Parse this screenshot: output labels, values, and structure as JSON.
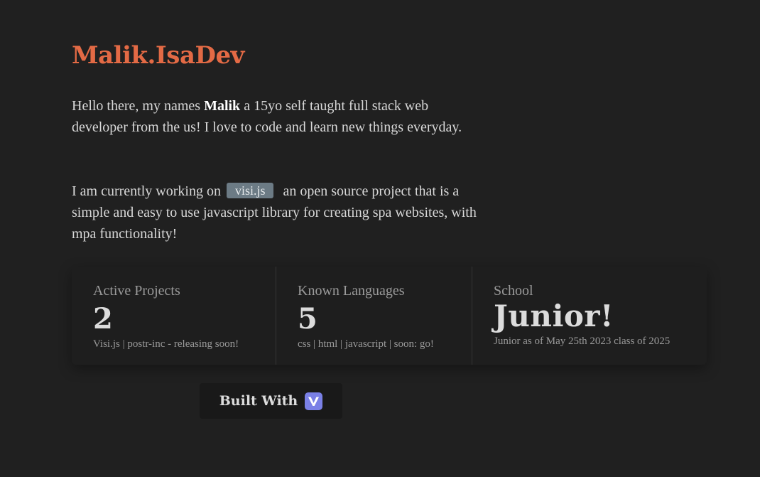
{
  "header": {
    "brand": "Malik.IsaDev"
  },
  "intro": {
    "p1_before": "Hello there, my names ",
    "p1_name": "Malik",
    "p1_after": " a 15yo self taught full stack web developer from the us! I love to code and learn new things everyday.",
    "p2_before": "I am currently working on",
    "p2_project": "visi.js",
    "p2_after": " an open source project that is a simple and easy to use javascript library for creating spa websites, with mpa functionality!"
  },
  "stats": [
    {
      "title": "Active Projects",
      "value": "2",
      "desc": "Visi.js | postr-inc - releasing soon!"
    },
    {
      "title": "Known Languages",
      "value": "5",
      "desc": "css | html | javascript | soon: go!"
    },
    {
      "title": "School",
      "value": "Junior!",
      "desc": "Junior as of May 25th 2023 class of 2025"
    }
  ],
  "built_with": {
    "label": "Built With",
    "icon": "vite-v-logo-icon",
    "icon_color": "#7a80e6"
  },
  "colors": {
    "background": "#202020",
    "brand": "#e36a45",
    "pill": "#6c7b85"
  }
}
